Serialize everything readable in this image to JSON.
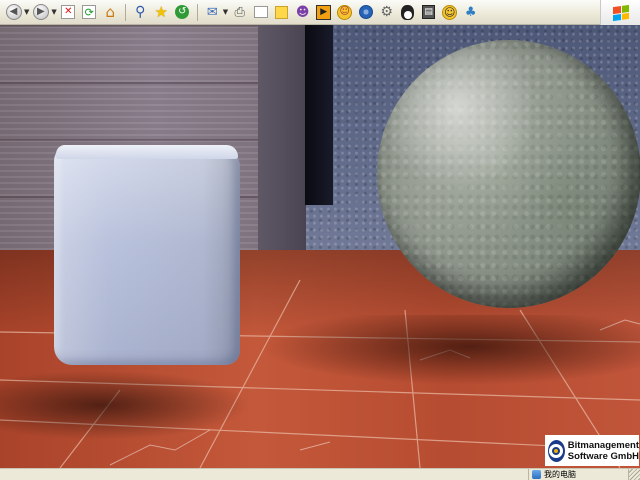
{
  "toolbar": {
    "items": [
      {
        "name": "back-button",
        "glyph": "◀",
        "icon": "back-arrow-icon"
      },
      {
        "name": "forward-button",
        "glyph": "▶",
        "icon": "forward-arrow-icon"
      },
      {
        "name": "stop-button",
        "glyph": "✕",
        "icon": "stop-icon"
      },
      {
        "name": "refresh-button",
        "glyph": "⟳",
        "icon": "refresh-icon"
      },
      {
        "name": "home-button",
        "glyph": "⌂",
        "icon": "home-icon"
      },
      {
        "name": "search-button",
        "glyph": "⚲",
        "icon": "search-icon"
      },
      {
        "name": "favorites-button",
        "glyph": "★",
        "icon": "star-icon"
      },
      {
        "name": "history-button",
        "glyph": "↺",
        "icon": "history-icon"
      },
      {
        "name": "mail-button",
        "glyph": "✉",
        "icon": "mail-icon"
      },
      {
        "name": "print-button",
        "glyph": "⎙",
        "icon": "printer-icon"
      },
      {
        "name": "edit-button",
        "glyph": "✎",
        "icon": "edit-icon"
      },
      {
        "name": "notes-button",
        "glyph": "▭",
        "icon": "notes-icon"
      },
      {
        "name": "messenger-button",
        "glyph": "☻",
        "icon": "messenger-icon"
      },
      {
        "name": "media-button",
        "glyph": "▶",
        "icon": "media-icon"
      },
      {
        "name": "emoticon-button",
        "glyph": "☺",
        "icon": "emoticon-icon"
      },
      {
        "name": "network-button",
        "glyph": "◎",
        "icon": "network-icon"
      },
      {
        "name": "settings-button",
        "glyph": "⚙",
        "icon": "settings-icon"
      },
      {
        "name": "qq-button",
        "glyph": "♟",
        "icon": "penguin-icon"
      },
      {
        "name": "archive-button",
        "glyph": "▤",
        "icon": "archive-icon"
      },
      {
        "name": "smiley-button",
        "glyph": "☺",
        "icon": "smiley-icon"
      },
      {
        "name": "tray-button",
        "glyph": "♣",
        "icon": "tray-icon"
      }
    ],
    "windows_logo": "windows-flag-icon"
  },
  "logo": {
    "line1": "Bitmanagement",
    "line2": "Software GmbH"
  },
  "statusbar": {
    "zone_label": "我的电脑",
    "zone_icon": "computer-icon"
  },
  "colors": {
    "floor": "#b64c31",
    "backwall": "#5f6a8c",
    "cube": "#b9c2dc",
    "sphere": "#8e958b",
    "logo_blue": "#1a3a8a"
  }
}
